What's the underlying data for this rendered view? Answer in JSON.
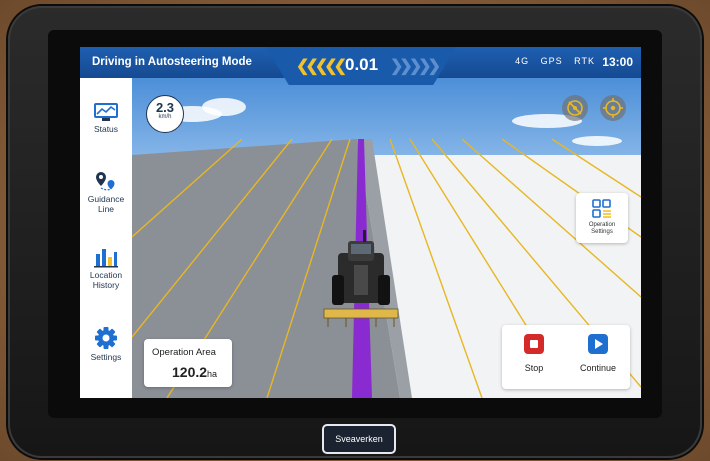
{
  "header": {
    "mode_title": "Driving in Autosteering Mode",
    "offset_value": "0.01",
    "signal_1": "4G",
    "signal_2": "GPS",
    "signal_3": "RTK",
    "clock": "13:00"
  },
  "speed": {
    "value": "2.3",
    "unit": "km/h"
  },
  "sidebar": {
    "items": [
      {
        "label": "Status",
        "icon": "monitor-chart-icon"
      },
      {
        "label": "Guidance Line",
        "icon": "route-pin-icon"
      },
      {
        "label": "Location History",
        "icon": "bar-chart-icon"
      },
      {
        "label": "Settings",
        "icon": "gear-icon"
      }
    ]
  },
  "operation_settings": {
    "line1": "Operation",
    "line2": "Settings"
  },
  "operation_area": {
    "title": "Operation Area",
    "value": "120.2",
    "unit": "ha"
  },
  "actions": {
    "stop_label": "Stop",
    "continue_label": "Continue"
  },
  "brand": "Sveaverken",
  "colors": {
    "header_blue": "#1a5aab",
    "guidance_line": "#8a2ad1",
    "stop_red": "#d42a2a",
    "continue_blue": "#1f6fd1",
    "field_lines": "#e8b724"
  }
}
